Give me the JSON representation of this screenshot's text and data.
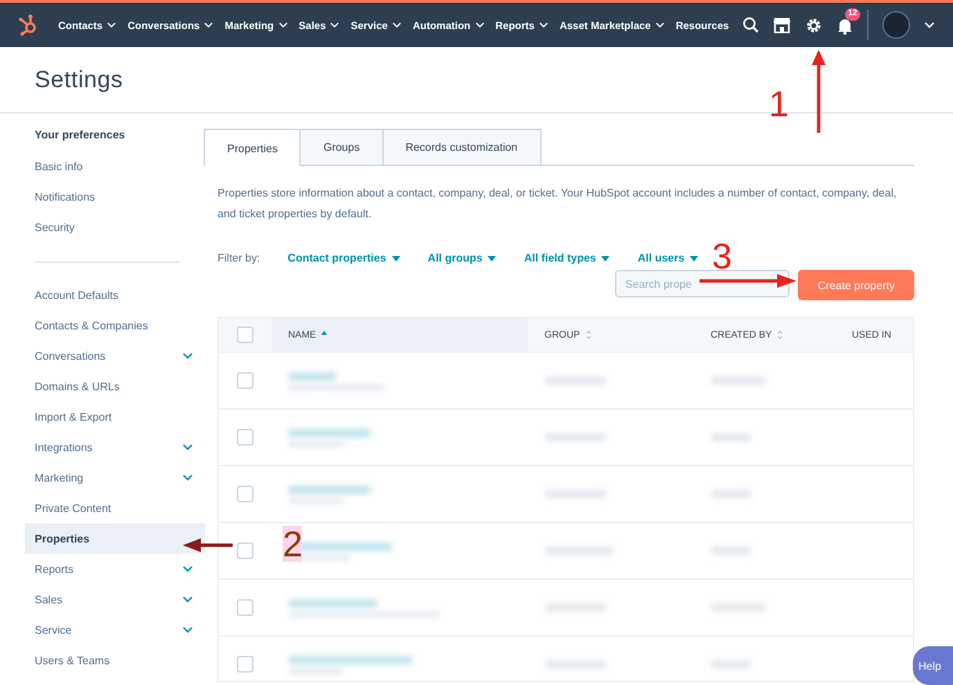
{
  "top_nav": {
    "items": [
      {
        "label": "Contacts",
        "dropdown": true
      },
      {
        "label": "Conversations",
        "dropdown": true
      },
      {
        "label": "Marketing",
        "dropdown": true
      },
      {
        "label": "Sales",
        "dropdown": true
      },
      {
        "label": "Service",
        "dropdown": true
      },
      {
        "label": "Automation",
        "dropdown": true
      },
      {
        "label": "Reports",
        "dropdown": true
      },
      {
        "label": "Asset Marketplace",
        "dropdown": true
      },
      {
        "label": "Resources",
        "dropdown": false
      }
    ],
    "notification_badge": "12"
  },
  "page_title": "Settings",
  "sidebar": {
    "sections": [
      {
        "title": "Your preferences",
        "items": [
          {
            "label": "Basic info",
            "selected": false,
            "expandable": false
          },
          {
            "label": "Notifications",
            "selected": false,
            "expandable": false
          },
          {
            "label": "Security",
            "selected": false,
            "expandable": false
          }
        ]
      },
      {
        "items": [
          {
            "label": "Account Defaults",
            "selected": false,
            "expandable": false
          },
          {
            "label": "Contacts & Companies",
            "selected": false,
            "expandable": false
          },
          {
            "label": "Conversations",
            "selected": false,
            "expandable": true
          },
          {
            "label": "Domains & URLs",
            "selected": false,
            "expandable": false
          },
          {
            "label": "Import & Export",
            "selected": false,
            "expandable": false
          },
          {
            "label": "Integrations",
            "selected": false,
            "expandable": true
          },
          {
            "label": "Marketing",
            "selected": false,
            "expandable": true
          },
          {
            "label": "Private Content",
            "selected": false,
            "expandable": false
          },
          {
            "label": "Properties",
            "selected": true,
            "expandable": false
          },
          {
            "label": "Reports",
            "selected": false,
            "expandable": true
          },
          {
            "label": "Sales",
            "selected": false,
            "expandable": true
          },
          {
            "label": "Service",
            "selected": false,
            "expandable": true
          },
          {
            "label": "Users & Teams",
            "selected": false,
            "expandable": false
          }
        ]
      }
    ]
  },
  "tabs": [
    {
      "label": "Properties",
      "selected": true
    },
    {
      "label": "Groups",
      "selected": false
    },
    {
      "label": "Records customization",
      "selected": false
    }
  ],
  "description": "Properties store information about a contact, company, deal, or ticket. Your HubSpot account includes a number of contact, company, deal, and ticket properties by default.",
  "filters": {
    "label": "Filter by:",
    "options": [
      "Contact properties",
      "All groups",
      "All field types",
      "All users"
    ]
  },
  "search": {
    "placeholder": "Search prope"
  },
  "create_button": "Create property",
  "table": {
    "select_all_checked": false,
    "columns": [
      {
        "label": "NAME",
        "sorted": true
      },
      {
        "label": "GROUP",
        "sorted": false
      },
      {
        "label": "CREATED BY",
        "sorted": false
      },
      {
        "label": "USED IN"
      }
    ],
    "rows": [
      {
        "checked": false
      },
      {
        "checked": false
      },
      {
        "checked": false
      },
      {
        "checked": false
      },
      {
        "checked": false
      },
      {
        "checked": false
      }
    ]
  },
  "help_button": "Help",
  "annotations": [
    {
      "label": "1"
    },
    {
      "label": "2"
    },
    {
      "label": "3"
    }
  ]
}
